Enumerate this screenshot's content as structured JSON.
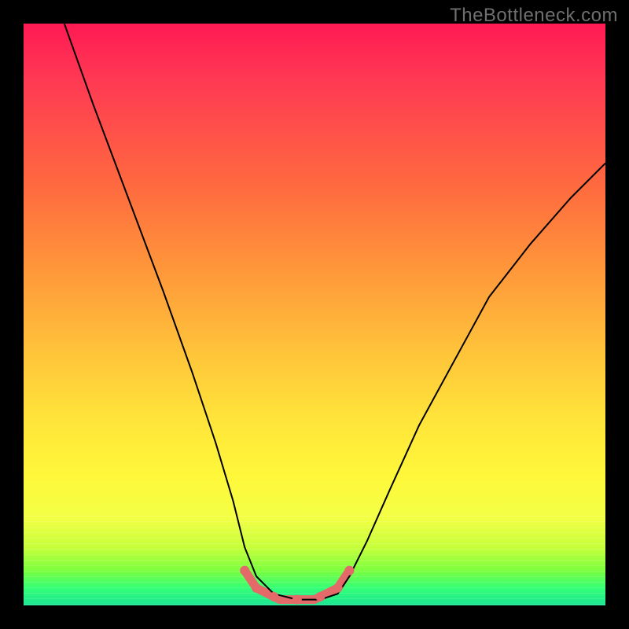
{
  "watermark": "TheBottleneck.com",
  "chart_data": {
    "type": "line",
    "title": "",
    "xlabel": "",
    "ylabel": "",
    "xlim": [
      0,
      100
    ],
    "ylim": [
      0,
      100
    ],
    "legend": false,
    "grid": false,
    "series": [
      {
        "name": "bottleneck-curve",
        "x": [
          7,
          12,
          18,
          24,
          29,
          33,
          36,
          38,
          40,
          43,
          47,
          51,
          54,
          56,
          59,
          63,
          68,
          74,
          80,
          87,
          94,
          100
        ],
        "values": [
          100,
          86,
          70,
          54,
          40,
          28,
          18,
          10,
          5,
          2,
          1,
          1,
          2,
          5,
          11,
          20,
          31,
          42,
          53,
          62,
          70,
          76
        ],
        "stroke": "#000000",
        "stroke_width": 2
      },
      {
        "name": "valley-highlight",
        "x": [
          38,
          40,
          42,
          44,
          47,
          50,
          52,
          54,
          56
        ],
        "values": [
          6,
          3,
          2,
          1,
          1,
          1,
          2,
          3,
          6
        ],
        "stroke": "#e46a6a",
        "stroke_width": 11,
        "caps": "round"
      }
    ],
    "markers": {
      "name": "valley-dots",
      "x": [
        38,
        40,
        43,
        47,
        51,
        54,
        56
      ],
      "values": [
        6,
        3,
        1.5,
        1,
        1.5,
        3,
        6
      ],
      "color": "#e46a6a",
      "radius": 6
    },
    "background": {
      "type": "vertical-gradient",
      "stops": [
        {
          "pos": 0.0,
          "color": "#ff1a53"
        },
        {
          "pos": 0.28,
          "color": "#ff6a3f"
        },
        {
          "pos": 0.56,
          "color": "#ffc23a"
        },
        {
          "pos": 0.78,
          "color": "#fff83a"
        },
        {
          "pos": 0.94,
          "color": "#7cff3f"
        },
        {
          "pos": 1.0,
          "color": "#1be693"
        }
      ]
    }
  }
}
